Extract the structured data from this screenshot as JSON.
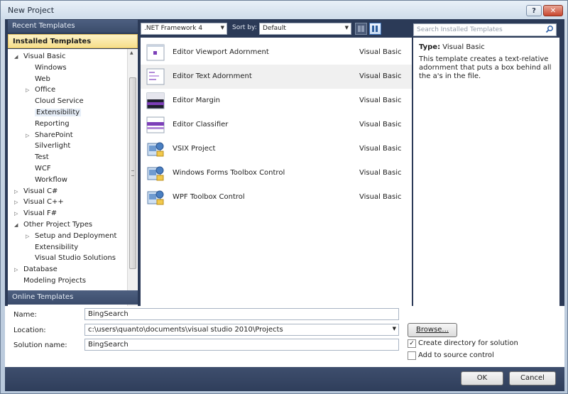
{
  "window": {
    "title": "New Project"
  },
  "left": {
    "recent_label": "Recent Templates",
    "installed_label": "Installed Templates",
    "online_label": "Online Templates",
    "tree": [
      {
        "label": "Visual Basic",
        "level": 0,
        "arrow": "expanded"
      },
      {
        "label": "Windows",
        "level": 1,
        "arrow": "none"
      },
      {
        "label": "Web",
        "level": 1,
        "arrow": "none"
      },
      {
        "label": "Office",
        "level": 1,
        "arrow": "collapsed"
      },
      {
        "label": "Cloud Service",
        "level": 1,
        "arrow": "none"
      },
      {
        "label": "Extensibility",
        "level": 1,
        "arrow": "none",
        "selected": true
      },
      {
        "label": "Reporting",
        "level": 1,
        "arrow": "none"
      },
      {
        "label": "SharePoint",
        "level": 1,
        "arrow": "collapsed"
      },
      {
        "label": "Silverlight",
        "level": 1,
        "arrow": "none"
      },
      {
        "label": "Test",
        "level": 1,
        "arrow": "none"
      },
      {
        "label": "WCF",
        "level": 1,
        "arrow": "none"
      },
      {
        "label": "Workflow",
        "level": 1,
        "arrow": "none"
      },
      {
        "label": "Visual C#",
        "level": 0,
        "arrow": "collapsed"
      },
      {
        "label": "Visual C++",
        "level": 0,
        "arrow": "collapsed"
      },
      {
        "label": "Visual F#",
        "level": 0,
        "arrow": "collapsed"
      },
      {
        "label": "Other Project Types",
        "level": 0,
        "arrow": "expanded"
      },
      {
        "label": "Setup and Deployment",
        "level": 1,
        "arrow": "collapsed"
      },
      {
        "label": "Extensibility",
        "level": 1,
        "arrow": "none"
      },
      {
        "label": "Visual Studio Solutions",
        "level": 1,
        "arrow": "none"
      },
      {
        "label": "Database",
        "level": 0,
        "arrow": "collapsed"
      },
      {
        "label": "Modeling Projects",
        "level": 0,
        "arrow": "none"
      }
    ]
  },
  "toolbar": {
    "framework": ".NET Framework 4",
    "sortby_label": "Sort by:",
    "sortby_value": "Default"
  },
  "templates": [
    {
      "name": "Editor Viewport Adornment",
      "lang": "Visual Basic",
      "icon": "viewport-adornment-icon"
    },
    {
      "name": "Editor Text Adornment",
      "lang": "Visual Basic",
      "icon": "text-adornment-icon",
      "selected": true
    },
    {
      "name": "Editor Margin",
      "lang": "Visual Basic",
      "icon": "editor-margin-icon"
    },
    {
      "name": "Editor Classifier",
      "lang": "Visual Basic",
      "icon": "editor-classifier-icon"
    },
    {
      "name": "VSIX Project",
      "lang": "Visual Basic",
      "icon": "vsix-project-icon"
    },
    {
      "name": "Windows Forms Toolbox Control",
      "lang": "Visual Basic",
      "icon": "winforms-toolbox-icon"
    },
    {
      "name": "WPF Toolbox Control",
      "lang": "Visual Basic",
      "icon": "wpf-toolbox-icon"
    }
  ],
  "search": {
    "placeholder": "Search Installed Templates"
  },
  "details": {
    "type_label": "Type:",
    "type_value": "Visual Basic",
    "description": "This template creates a text-relative adornment that puts a box behind all the a's in the file."
  },
  "form": {
    "name_label": "Name:",
    "name_value": "BingSearch",
    "location_label": "Location:",
    "location_value": "c:\\users\\quanto\\documents\\visual studio 2010\\Projects",
    "solution_label": "Solution name:",
    "solution_value": "BingSearch",
    "browse_label": "Browse...",
    "create_dir_label": "Create directory for solution",
    "create_dir_checked": true,
    "source_control_label": "Add to source control",
    "source_control_checked": false
  },
  "buttons": {
    "ok": "OK",
    "cancel": "Cancel"
  },
  "colors": {
    "chrome_dark": "#2b3a57",
    "selection_yellow": "#f6de8a",
    "accent_purple": "#7c3fb8"
  }
}
